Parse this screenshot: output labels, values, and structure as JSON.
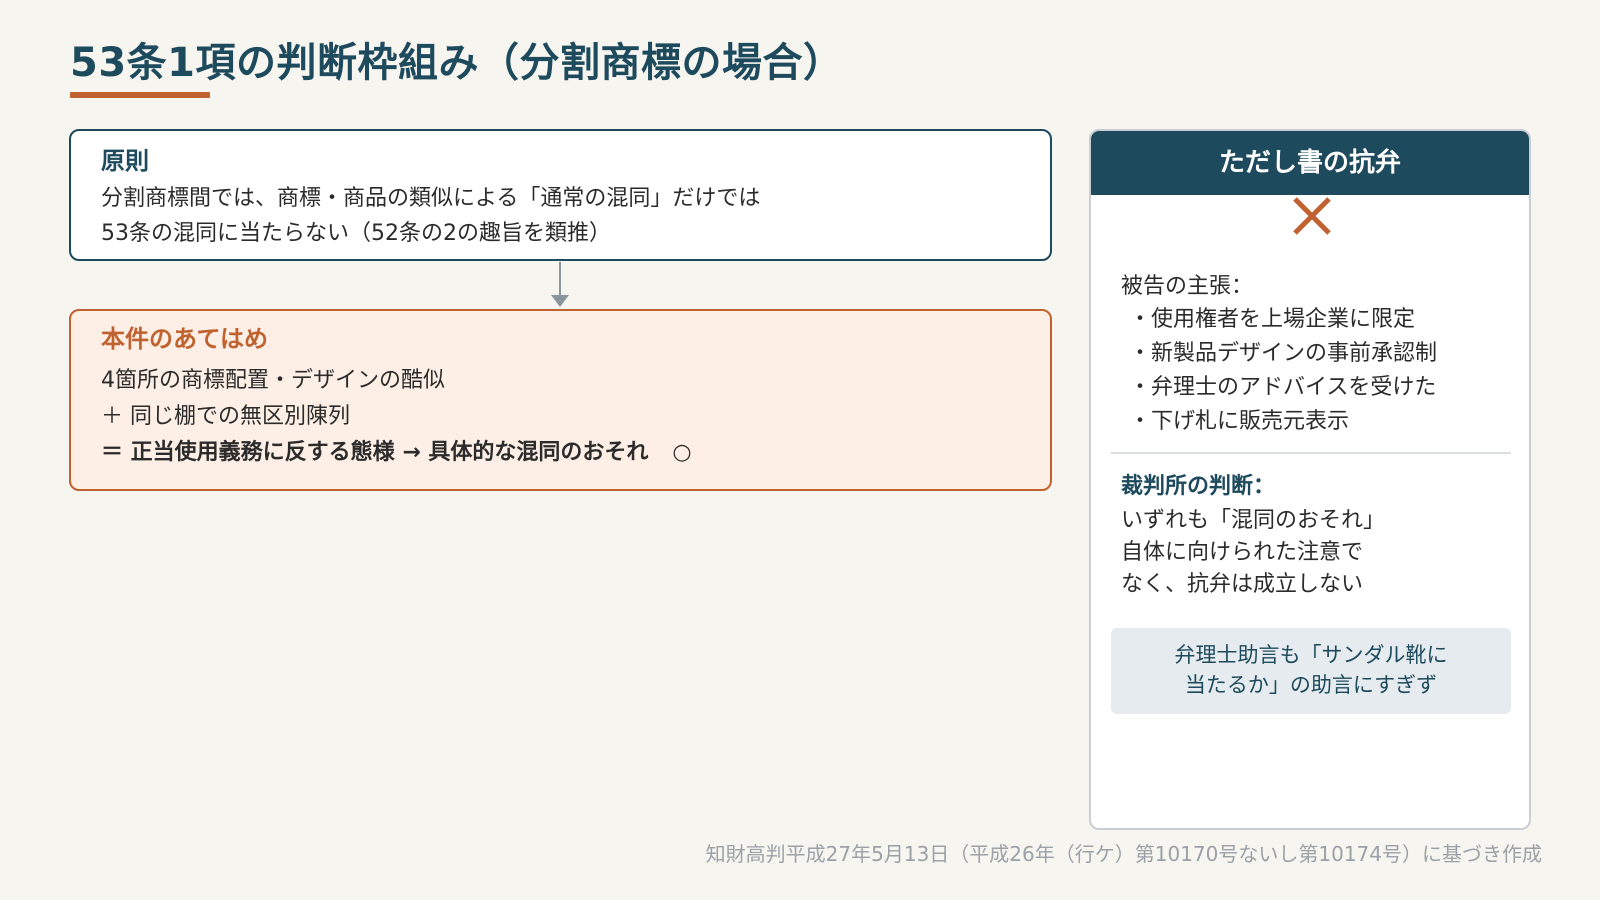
{
  "title": "53条1項の判断枠組み（分割商標の場合）",
  "principle": {
    "heading": "原則",
    "lines": [
      "分割商標間では、商標・商品の類似による「通常の混同」だけでは",
      "53条の混同に当たらない（52条の2の趣旨を類推）"
    ]
  },
  "application": {
    "heading": "本件のあてはめ",
    "line1": "4箇所の商標配置・デザインの酷似",
    "line2": "＋ 同じ棚での無区別陳列",
    "conclusion": "＝ 正当使用義務に反する態様 → 具体的な混同のおそれ",
    "mark": "○"
  },
  "defense": {
    "header": "ただし書の抗弁",
    "result_icon": "cross-icon",
    "claim_label": "被告の主張：",
    "claims": [
      "・使用権者を上場企業に限定",
      "・新製品デザインの事前承認制",
      "・弁理士のアドバイスを受けた",
      "・下げ札に販売元表示"
    ],
    "court_label": "裁判所の判断：",
    "court_lines": [
      "いずれも「混同のおそれ」",
      "自体に向けられた注意で",
      "なく、抗弁は成立しない"
    ],
    "note_lines": [
      "弁理士助言も「サンダル靴に",
      "当たるか」の助言にすぎず"
    ]
  },
  "footer": "知財高判平成27年5月13日（平成26年（行ケ）第10170号ないし第10174号）に基づき作成",
  "colors": {
    "navy": "#1d4a5c",
    "orange": "#c0622f",
    "background": "#f7f5f0"
  }
}
